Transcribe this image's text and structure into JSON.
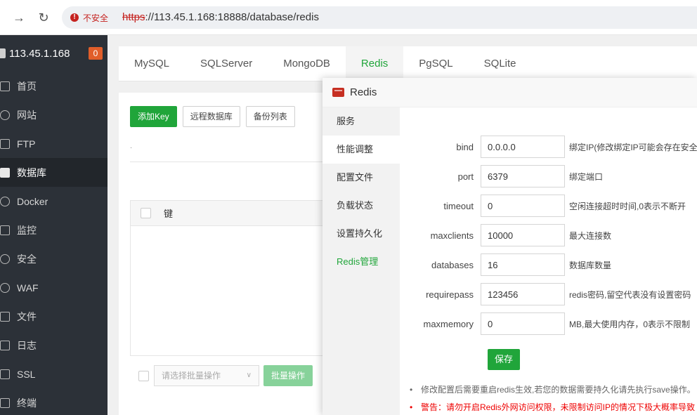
{
  "browser": {
    "insecure_label": "不安全",
    "url_scheme": "https",
    "url_rest": "://113.45.1.168:18888/database/redis"
  },
  "sidebar": {
    "server_name": "113.45.1.168",
    "badge": "0",
    "items": [
      {
        "label": "首页",
        "icon": "home-icon"
      },
      {
        "label": "网站",
        "icon": "globe-icon"
      },
      {
        "label": "FTP",
        "icon": "ftp-icon"
      },
      {
        "label": "数据库",
        "icon": "database-icon"
      },
      {
        "label": "Docker",
        "icon": "docker-icon"
      },
      {
        "label": "监控",
        "icon": "monitor-icon"
      },
      {
        "label": "安全",
        "icon": "shield-icon"
      },
      {
        "label": "WAF",
        "icon": "waf-icon"
      },
      {
        "label": "文件",
        "icon": "folder-icon"
      },
      {
        "label": "日志",
        "icon": "log-icon"
      },
      {
        "label": "SSL",
        "icon": "ssl-icon"
      },
      {
        "label": "终端",
        "icon": "terminal-icon"
      }
    ]
  },
  "tabs": [
    "MySQL",
    "SQLServer",
    "MongoDB",
    "Redis",
    "PgSQL",
    "SQLite"
  ],
  "toolbar": {
    "add_key": "添加Key",
    "remote_db": "远程数据库",
    "backup_list": "备份列表"
  },
  "table": {
    "col_key": "键"
  },
  "bottom": {
    "batch_placeholder": "请选择批量操作",
    "batch_button": "批量操作"
  },
  "dialog": {
    "title": "Redis",
    "nav": [
      "服务",
      "性能调整",
      "配置文件",
      "负载状态",
      "设置持久化",
      "Redis管理"
    ],
    "fields": [
      {
        "label": "bind",
        "value": "0.0.0.0",
        "desc": "绑定IP(修改绑定IP可能会存在安全"
      },
      {
        "label": "port",
        "value": "6379",
        "desc": "绑定端口"
      },
      {
        "label": "timeout",
        "value": "0",
        "desc": "空闲连接超时时间,0表示不断开"
      },
      {
        "label": "maxclients",
        "value": "10000",
        "desc": "最大连接数"
      },
      {
        "label": "databases",
        "value": "16",
        "desc": "数据库数量"
      },
      {
        "label": "requirepass",
        "value": "123456",
        "desc": "redis密码,留空代表没有设置密码"
      },
      {
        "label": "maxmemory",
        "value": "0",
        "desc": "MB,最大使用内存，0表示不限制"
      }
    ],
    "save_label": "保存",
    "notes": [
      "修改配置后需要重启redis生效,若您的数据需要持久化请先执行save操作。",
      "警告：请勿开启Redis外网访问权限，未限制访问IP的情况下极大概率导致"
    ]
  },
  "colors": {
    "accent": "#20a53a",
    "sidebar_bg": "#2c3138",
    "danger": "#e00000",
    "badge": "#e15e2a"
  }
}
